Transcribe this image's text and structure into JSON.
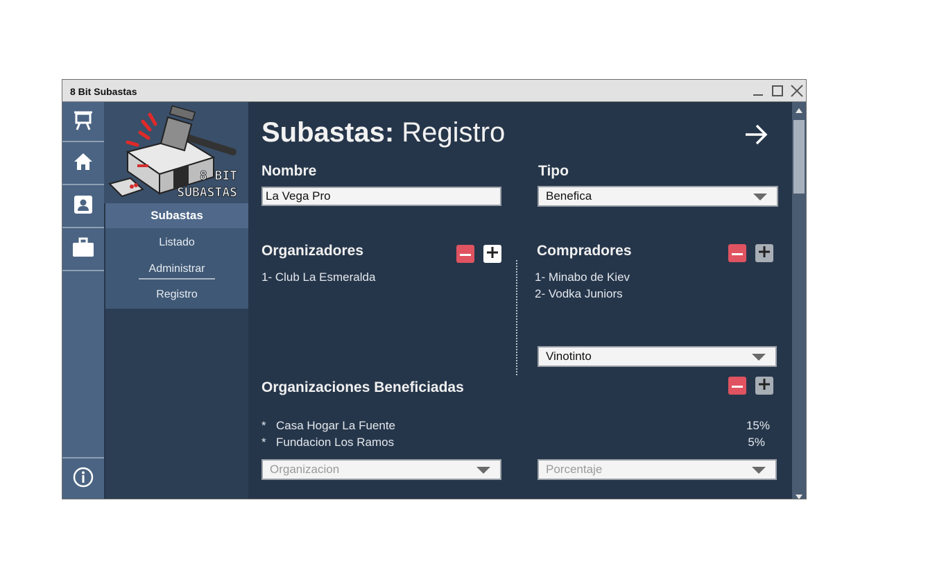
{
  "window": {
    "title": "8 Bit Subastas"
  },
  "logo": {
    "line1": "8 BIT",
    "line2": "SUBASTAS"
  },
  "nav": {
    "items": [
      {
        "icon": "presentation-board-icon"
      },
      {
        "icon": "home-icon"
      },
      {
        "icon": "contact-card-icon"
      },
      {
        "icon": "briefcase-icon"
      },
      {
        "icon": "info-icon"
      }
    ]
  },
  "submenu": {
    "header": "Subastas",
    "links": [
      "Listado",
      "Administrar",
      "Registro"
    ]
  },
  "page": {
    "title_bold": "Subastas:",
    "title_rest": " Registro",
    "next_icon": "arrow-right-icon"
  },
  "form": {
    "nombre_label": "Nombre",
    "nombre_value": "La Vega Pro",
    "tipo_label": "Tipo",
    "tipo_value": "Benefica",
    "organizadores": {
      "label": "Organizadores",
      "items": [
        "1- Club La Esmeralda"
      ]
    },
    "compradores": {
      "label": "Compradores",
      "items": [
        "1- Minabo de Kiev",
        "2- Vodka Juniors"
      ],
      "select_value": "Vinotinto"
    },
    "beneficiadas": {
      "label": "Organizaciones Beneficiadas",
      "rows": [
        {
          "bullet": "*",
          "name": "Casa Hogar La Fuente",
          "pct": "15%"
        },
        {
          "bullet": "*",
          "name": "Fundacion Los Ramos",
          "pct": "5%"
        }
      ],
      "org_placeholder": "Organizacion",
      "pct_placeholder": "Porcentaje"
    }
  },
  "colors": {
    "background": "#26364a",
    "nav": "#4b6483",
    "minus_button": "#e05360",
    "titlebar": "#e2e2e2"
  }
}
